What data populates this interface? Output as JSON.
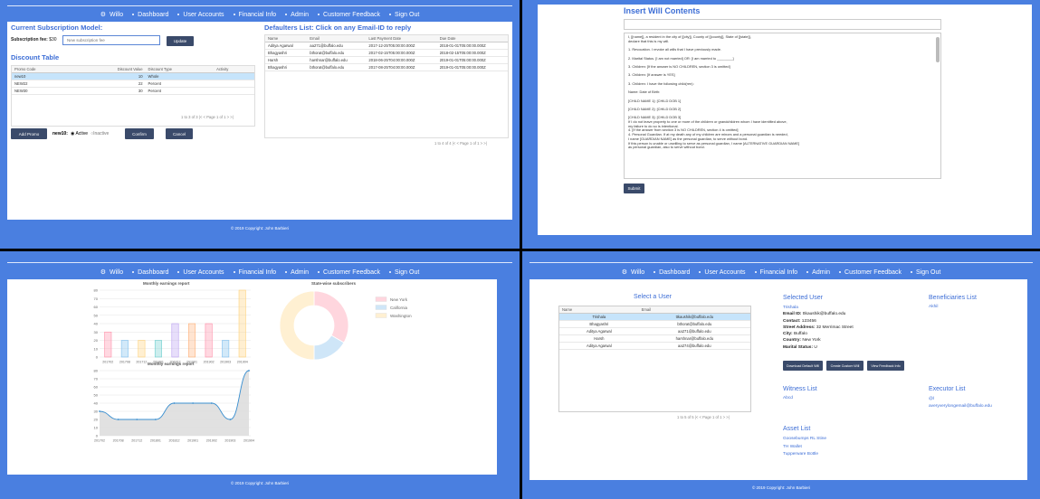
{
  "nav": {
    "brand": "Willo",
    "items": [
      "Dashboard",
      "User Accounts",
      "Financial Info",
      "Admin",
      "Customer Feedback",
      "Sign Out"
    ]
  },
  "footer": "© 2019 Copyright: John Barbieri",
  "subscription": {
    "heading": "Current Subscription Model:",
    "fee_label": "Subscription fee:",
    "fee_value": "$30",
    "fee_placeholder": "New subscription fee",
    "update_label": "Update"
  },
  "discount": {
    "heading": "Discount Table",
    "columns": [
      "Promo Code",
      "Discount Value",
      "Discount Type",
      "Activity"
    ],
    "rows": [
      [
        "new10",
        "10",
        "Whole",
        ""
      ],
      [
        "NEW22",
        "22",
        "Percent",
        ""
      ],
      [
        "NEW30",
        "30",
        "Percent",
        ""
      ]
    ],
    "pager": "1 to 3 of 3   |<  <  Page 1 of 1  >  >|",
    "add_label": "Add Promo",
    "selected_code": "new10:",
    "active_label": "Active",
    "inactive_label": "Inactive",
    "confirm_label": "Confirm",
    "cancel_label": "Cancel"
  },
  "defaulters": {
    "heading": "Defaulters List: Click on any Email-ID to reply",
    "columns": [
      "Name",
      "Email",
      "Last Payment Date",
      "Due Date"
    ],
    "rows": [
      [
        "Aditya Agarwal",
        "aa271@buffalo.edu",
        "2017-12-25T05:00:00.000Z",
        "2018-01-01T05:00:00.000Z"
      ],
      [
        "Bhagyashri",
        "bthorat@buffalo.edu",
        "2017-02-15T05:00:00.000Z",
        "2018-02-15T05:00:00.000Z"
      ],
      [
        "Harsh",
        "harshnar@buffalo.edu",
        "2018-06-25T04:00:00.000Z",
        "2019-01-01T05:00:00.000Z"
      ],
      [
        "Bhagyashri",
        "bthorat@buffalo.edu",
        "2017-08-25T04:00:00.000Z",
        "2019-01-01T05:00:00.000Z"
      ]
    ],
    "pager": "1 to 4 of 4   |<  <  Page 1 of 1  >  >|"
  },
  "will": {
    "heading": "Insert Will Contents",
    "lines": [
      "I, [[name]], a resident in the city of [[city]], County of [[county]], State of [[state]],",
      "declare that this is my will.",
      "",
      "1. Revocation. I revoke all wills that I have previously made.",
      "",
      "2. Marital Status. [I am not married] OR: [I am married to ________]",
      "",
      "3. Children: [If the answer is NO CHILDREN, section 3 is omitted]",
      "",
      "3. Children: [If answer is YES]",
      "",
      "3. Children: I have the following child(ren):",
      "",
      "Name: Date of Birth:",
      "",
      "[CHILD NAME 1]: [CHILD DOB 1]",
      "",
      "[CHILD NAME 2]: [CHILD DOB 2]",
      "",
      "[CHILD NAME 3]: [CHILD DOB 3]",
      "If I do not leave property to one or more of the children or grandchildren whom I have identified above,",
      " my failure to do so is intentional.",
      "4. [If the answer from section 3 is NO CHILDREN, section 4 is omitted]",
      "4. Personal Guardian. If at my death any of my children are minors and a personal guardian is needed,",
      "I name [GUARDIAN NAME] as the personal guardian, to serve without bond.",
      "If this person is unable or unwilling to serve as personal guardian, I name [ALTERNATIVE GUARDIAN NAME]",
      "as personal guardian, also to serve without bond."
    ],
    "submit_label": "Submit"
  },
  "charts": {
    "bar_title": "Monthly earnings report",
    "pie_title": "State-wise subscribers",
    "line_title": "Monthly earnings report"
  },
  "chart_data": [
    {
      "type": "bar",
      "title": "Monthly earnings report",
      "categories": [
        "201702",
        "201708",
        "201712",
        "201801",
        "201812",
        "201901",
        "201902",
        "201903",
        "201904"
      ],
      "values": [
        30,
        20,
        20,
        20,
        40,
        40,
        40,
        20,
        80
      ],
      "ylim": [
        0,
        80
      ],
      "yticks": [
        0,
        10,
        20,
        30,
        40,
        50,
        60,
        70,
        80
      ],
      "colors": [
        "#ff8fa8",
        "#7fbfef",
        "#ffd27a",
        "#6fcfcf",
        "#b9a0f0",
        "#ffb27a",
        "#ff8fa8",
        "#7fbfef",
        "#ffd27a"
      ]
    },
    {
      "type": "pie",
      "title": "State-wise subscribers",
      "labels": [
        "New York",
        "California",
        "Washington"
      ],
      "values": [
        2,
        1,
        3
      ],
      "colors": [
        "#ffd6de",
        "#cfe6f8",
        "#fff0d2"
      ],
      "legend": "right"
    },
    {
      "type": "area",
      "title": "Monthly earnings report",
      "categories": [
        "201702",
        "201708",
        "201712",
        "201801",
        "201812",
        "201901",
        "201902",
        "201903",
        "201904"
      ],
      "values": [
        30,
        20,
        20,
        20,
        40,
        40,
        40,
        20,
        80
      ],
      "ylim": [
        0,
        80
      ],
      "yticks": [
        0,
        10,
        20,
        30,
        40,
        50,
        60,
        70,
        80
      ]
    }
  ],
  "users": {
    "heading": "Select a User",
    "columns": [
      "Name",
      "Email"
    ],
    "rows": [
      [
        "Trishala",
        "ttkaushik@buffalo.edu"
      ],
      [
        "Bhagyashri",
        "bthorat@buffalo.edu"
      ],
      [
        "Aditya Agarwal",
        "aa271@buffalo.edu"
      ],
      [
        "Harsh",
        "harshnar@buffalo.edu"
      ],
      [
        "Aditya Agarwal",
        "aa274@buffalo.edu"
      ]
    ],
    "pager": "1 to 5 of 5   |<  <  Page 1 of 1  >  >|"
  },
  "selected_user": {
    "heading": "Selected User",
    "name": "Trishala",
    "email_label": "Email ID:",
    "email": "ttkaushik@buffalo.edu",
    "contact_label": "Contact:",
    "contact": "123456",
    "address_label": "Street Address:",
    "address": "32 Merrimac Street",
    "city_label": "City:",
    "city": "Buffalo",
    "country_label": "Country:",
    "country": "New York",
    "marital_label": "Marital Status:",
    "marital": "U",
    "btn_default": "Download Default Will",
    "btn_custom": "Create Custom Will",
    "btn_feedback": "View Feedback Info"
  },
  "beneficiaries": {
    "heading": "Beneficiaries List",
    "items": [
      "Akhil"
    ]
  },
  "witness": {
    "heading": "Witness List",
    "items": [
      "Abcd"
    ]
  },
  "executor": {
    "heading": "Executor List",
    "items": [
      "@l",
      "averyverylongemail@buffalo.edu"
    ]
  },
  "assets": {
    "heading": "Asset List",
    "items": [
      "Goosebumps RL Stine",
      "TH Wallet",
      "Tupperware Bottle"
    ]
  }
}
